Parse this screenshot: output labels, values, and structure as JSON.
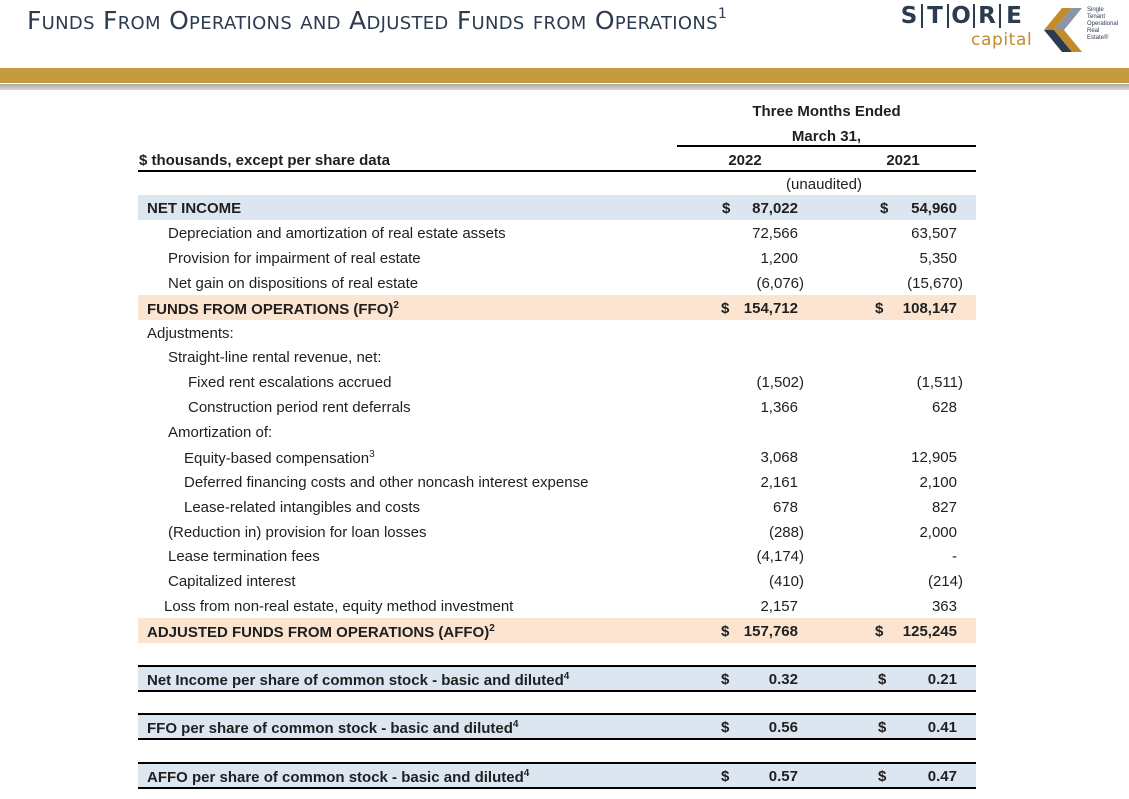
{
  "header": {
    "title": "Funds From Operations and Adjusted Funds from Operations",
    "title_superscript": "1"
  },
  "logo": {
    "letters": [
      "S",
      "T",
      "O",
      "R",
      "E"
    ],
    "capital": "capital",
    "tagline": [
      "Single",
      "Tenant",
      "Operational",
      "Real",
      "Estate®"
    ]
  },
  "colors": {
    "title": "#2c3b50",
    "gold_band": "#c69a3e",
    "row_blue": "#dce6f1",
    "row_tan": "#fbe5d1"
  },
  "table": {
    "period_header": [
      "Three Months Ended",
      "March 31,"
    ],
    "row_label_header": "$ thousands, except per share data",
    "year_2022": "2022",
    "year_2021": "2021",
    "unaudited": "(unaudited)",
    "rows": [
      {
        "label": "NET INCOME",
        "cur": "$",
        "v2022": "87,022",
        "v2021": "54,960"
      },
      {
        "label": "Depreciation and amortization of real estate assets",
        "v2022": "72,566",
        "v2021": "63,507"
      },
      {
        "label": "Provision for impairment of real estate",
        "v2022": "1,200",
        "v2021": "5,350"
      },
      {
        "label": "Net gain on dispositions of real estate",
        "v2022": "(6,076)",
        "v2021": "(15,670)"
      },
      {
        "label": "FUNDS FROM OPERATIONS (FFO)",
        "sup": "2",
        "cur": "$",
        "v2022": "154,712",
        "v2021": "108,147"
      },
      {
        "label": "Adjustments:"
      },
      {
        "label": "Straight-line rental revenue, net:"
      },
      {
        "label": "Fixed rent escalations accrued",
        "v2022": "(1,502)",
        "v2021": "(1,511)"
      },
      {
        "label": "Construction period rent deferrals",
        "v2022": "1,366",
        "v2021": "628"
      },
      {
        "label": "Amortization of:"
      },
      {
        "label": "Equity-based compensation",
        "sup": "3",
        "v2022": "3,068",
        "v2021": "12,905"
      },
      {
        "label": "Deferred financing costs and other noncash interest expense",
        "v2022": "2,161",
        "v2021": "2,100"
      },
      {
        "label": "Lease-related intangibles and costs",
        "v2022": "678",
        "v2021": "827"
      },
      {
        "label": "(Reduction in) provision for loan losses",
        "v2022": "(288)",
        "v2021": "2,000"
      },
      {
        "label": "Lease termination fees",
        "v2022": "(4,174)",
        "v2021": "-"
      },
      {
        "label": "Capitalized interest",
        "v2022": "(410)",
        "v2021": "(214)"
      },
      {
        "label": "Loss from non-real estate, equity method investment",
        "v2022": "2,157",
        "v2021": "363"
      },
      {
        "label": "ADJUSTED FUNDS FROM OPERATIONS (AFFO)",
        "sup": "2",
        "cur": "$",
        "v2022": "157,768",
        "v2021": "125,245"
      }
    ],
    "per_share": [
      {
        "label": "Net Income per share of common stock - basic and diluted",
        "sup": "4",
        "cur": "$",
        "v2022": "0.32",
        "v2021": "0.21"
      },
      {
        "label": "FFO per share of common stock - basic and diluted",
        "sup": "4",
        "cur": "$",
        "v2022": "0.56",
        "v2021": "0.41"
      },
      {
        "label": "AFFO per share of common stock - basic and diluted",
        "sup": "4",
        "cur": "$",
        "v2022": "0.57",
        "v2021": "0.47"
      }
    ]
  }
}
